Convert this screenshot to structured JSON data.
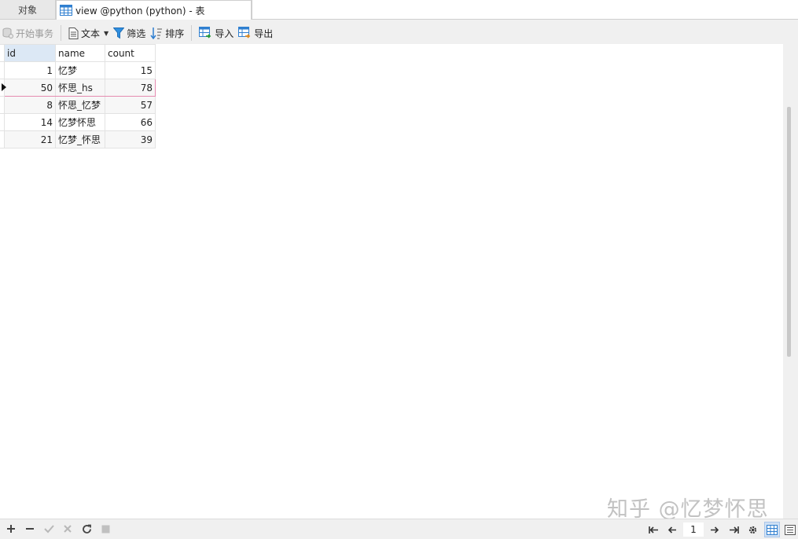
{
  "tabs": {
    "objects_label": "对象",
    "active_label": "view @python (python) - 表"
  },
  "toolbar": {
    "begin_transaction": "开始事务",
    "text": "文本",
    "filter": "筛选",
    "sort": "排序",
    "import": "导入",
    "export": "导出"
  },
  "grid": {
    "columns": [
      "id",
      "name",
      "count"
    ],
    "rows": [
      {
        "id": "1",
        "name": "忆梦",
        "count": "15"
      },
      {
        "id": "50",
        "name": "怀思_hs",
        "count": "78"
      },
      {
        "id": "8",
        "name": "怀思_忆梦",
        "count": "57"
      },
      {
        "id": "14",
        "name": "忆梦怀思",
        "count": "66"
      },
      {
        "id": "21",
        "name": "忆梦_怀思",
        "count": "39"
      }
    ],
    "current_row_index": 1
  },
  "pager": {
    "page": "1"
  },
  "watermark": "知乎 @忆梦怀思",
  "colors": {
    "header_selected": "#dce8f5",
    "current_row_border": "#e58bb0",
    "accent_blue": "#2f7fd0"
  }
}
